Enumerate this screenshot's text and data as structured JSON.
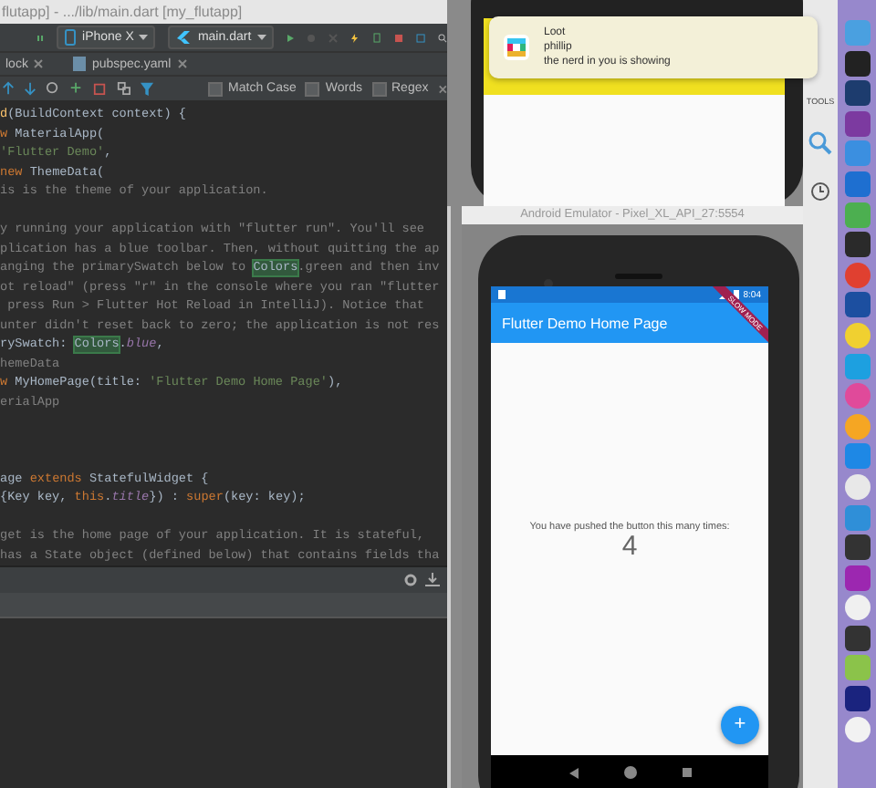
{
  "ide": {
    "title": "flutapp] - .../lib/main.dart [my_flutapp]",
    "device": "iPhone X",
    "run_config": "main.dart",
    "tabs": [
      {
        "label": "lock",
        "selected": false
      },
      {
        "label": "pubspec.yaml",
        "selected": false
      }
    ],
    "find_options": [
      {
        "label": "Match Case",
        "checked": false
      },
      {
        "label": "Words",
        "checked": false
      },
      {
        "label": "Regex",
        "checked": false
      }
    ],
    "code_lines": [
      {
        "kind": "code",
        "tokens": [
          {
            "kind": "method",
            "text": "d"
          },
          {
            "kind": "plain",
            "text": "(BuildContext context) {"
          }
        ]
      },
      {
        "kind": "code",
        "tokens": [
          {
            "kind": "keyword",
            "text": "w"
          },
          {
            "kind": "plain",
            "text": " MaterialApp("
          }
        ]
      },
      {
        "kind": "code",
        "tokens": [
          {
            "kind": "string",
            "text": "'Flutter Demo'"
          },
          {
            "kind": "plain",
            "text": ","
          }
        ]
      },
      {
        "kind": "code",
        "tokens": [
          {
            "kind": "keyword",
            "text": "new"
          },
          {
            "kind": "plain",
            "text": " ThemeData("
          }
        ]
      },
      {
        "kind": "code",
        "tokens": [
          {
            "kind": "comment",
            "text": "is is the theme of your application."
          }
        ]
      },
      {
        "kind": "blank"
      },
      {
        "kind": "code",
        "tokens": [
          {
            "kind": "comment",
            "text": "y running your application with \"flutter run\". You'll see"
          }
        ]
      },
      {
        "kind": "code",
        "tokens": [
          {
            "kind": "comment",
            "text": "plication has a blue toolbar. Then, without quitting the ap"
          }
        ]
      },
      {
        "kind": "code",
        "tokens": [
          {
            "kind": "comment",
            "text": "anging the primarySwatch below to "
          },
          {
            "kind": "match",
            "text": "Colors"
          },
          {
            "kind": "comment",
            "text": ".green and then inv"
          }
        ]
      },
      {
        "kind": "code",
        "tokens": [
          {
            "kind": "comment",
            "text": "ot reload\" (press \"r\" in the console where you ran \"flutter"
          }
        ]
      },
      {
        "kind": "code",
        "tokens": [
          {
            "kind": "comment",
            "text": " press Run > Flutter Hot Reload in IntelliJ). Notice that"
          }
        ]
      },
      {
        "kind": "code",
        "tokens": [
          {
            "kind": "comment",
            "text": "unter didn't reset back to zero; the application is not res"
          }
        ]
      },
      {
        "kind": "code",
        "tokens": [
          {
            "kind": "plain",
            "text": "rySwatch: "
          },
          {
            "kind": "match",
            "text": "Colors"
          },
          {
            "kind": "plain",
            "text": "."
          },
          {
            "kind": "field",
            "text": "blue"
          },
          {
            "kind": "plain",
            "text": ","
          }
        ]
      },
      {
        "kind": "code",
        "tokens": [
          {
            "kind": "comment",
            "text": "hemeData"
          }
        ]
      },
      {
        "kind": "code",
        "tokens": [
          {
            "kind": "keyword",
            "text": "w"
          },
          {
            "kind": "plain",
            "text": " MyHomePage(title: "
          },
          {
            "kind": "string",
            "text": "'Flutter Demo Home Page'"
          },
          {
            "kind": "plain",
            "text": "),"
          }
        ]
      },
      {
        "kind": "code",
        "tokens": [
          {
            "kind": "comment",
            "text": "erialApp"
          }
        ]
      },
      {
        "kind": "blank"
      },
      {
        "kind": "blank"
      },
      {
        "kind": "blank"
      },
      {
        "kind": "code",
        "tokens": [
          {
            "kind": "plain",
            "text": "age "
          },
          {
            "kind": "keyword",
            "text": "extends"
          },
          {
            "kind": "plain",
            "text": " StatefulWidget {"
          }
        ]
      },
      {
        "kind": "code",
        "tokens": [
          {
            "kind": "plain",
            "text": "{Key key, "
          },
          {
            "kind": "keyword",
            "text": "this"
          },
          {
            "kind": "plain",
            "text": "."
          },
          {
            "kind": "field",
            "text": "title"
          },
          {
            "kind": "plain",
            "text": "}) : "
          },
          {
            "kind": "keyword",
            "text": "super"
          },
          {
            "kind": "plain",
            "text": "(key: key);"
          }
        ]
      },
      {
        "kind": "blank"
      },
      {
        "kind": "code",
        "tokens": [
          {
            "kind": "comment",
            "text": "get is the home page of your application. It is stateful,"
          }
        ]
      },
      {
        "kind": "code",
        "tokens": [
          {
            "kind": "comment",
            "text": "has a State object (defined below) that contains fields tha"
          }
        ]
      }
    ]
  },
  "notification": {
    "app": "Loot",
    "sender": "phillip",
    "message": "the nerd in you is showing"
  },
  "side_panel": {
    "label": "TOOLS"
  },
  "emulator": {
    "title": "Android Emulator - Pixel_XL_API_27:5554",
    "time": "8:04",
    "banner": "SLOW MODE",
    "app_bar_title": "Flutter Demo Home Page",
    "body_text": "You have pushed the button this many times:",
    "counter": "4",
    "fab": "+"
  }
}
